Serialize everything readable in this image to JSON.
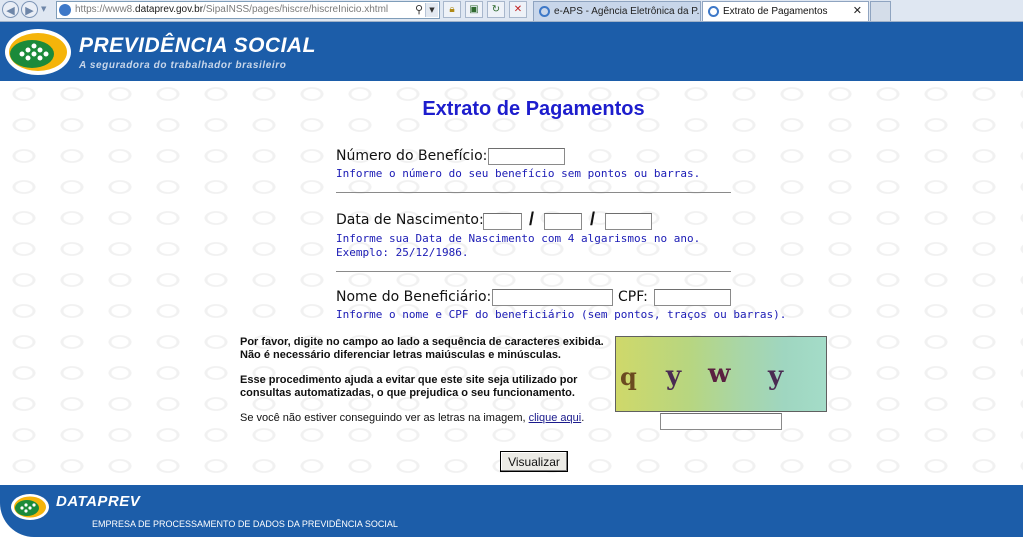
{
  "browser": {
    "url_prefix": "https://www8.",
    "url_domain": "dataprev.gov.br",
    "url_path": "/SipaINSS/pages/hiscre/hiscreInicio.xhtml",
    "tabs": [
      {
        "label": "e-APS - Agência Eletrônica da P..."
      },
      {
        "label": "Extrato de Pagamentos",
        "close": "✕"
      }
    ]
  },
  "header": {
    "title": "PREVIDÊNCIA SOCIAL",
    "subtitle": "A seguradora do trabalhador brasileiro"
  },
  "form": {
    "title": "Extrato de Pagamentos",
    "beneficio": {
      "label": "Número do Benefício:",
      "hint": "Informe o número do seu benefício sem pontos ou barras."
    },
    "nascimento": {
      "label": "Data de Nascimento:",
      "separator": "/",
      "hint": "Informe sua Data de Nascimento com 4 algarismos no ano.",
      "example": "Exemplo: 25/12/1986."
    },
    "beneficiario": {
      "label": "Nome do Beneficiário:",
      "cpf_label": "CPF:",
      "hint": "Informe o nome e CPF do beneficiário (sem pontos, traços ou barras)."
    },
    "captcha": {
      "instruction_1": "Por favor, digite no campo ao lado a sequência de caracteres exibida.",
      "instruction_2": "Não é necessário diferenciar letras maiúsculas e minúsculas.",
      "purpose_1": "Esse procedimento ajuda a evitar que este site seja utilizado por",
      "purpose_2": "consultas automatizadas, o que prejudica o seu funcionamento.",
      "help_prefix": "Se você não estiver conseguindo ver as letras na imagem, ",
      "help_link": "clique aqui",
      "help_suffix": ".",
      "image_chars": [
        "q",
        "y",
        "w",
        "y"
      ]
    },
    "submit_label": "Visualizar"
  },
  "footer": {
    "brand": "DATAPREV",
    "text": "EMPRESA DE PROCESSAMENTO DE DADOS DA PREVIDÊNCIA SOCIAL"
  },
  "colors": {
    "header_blue": "#1c5da9",
    "title_blue": "#1d1dcd",
    "hint_blue": "#1b1bb5"
  }
}
